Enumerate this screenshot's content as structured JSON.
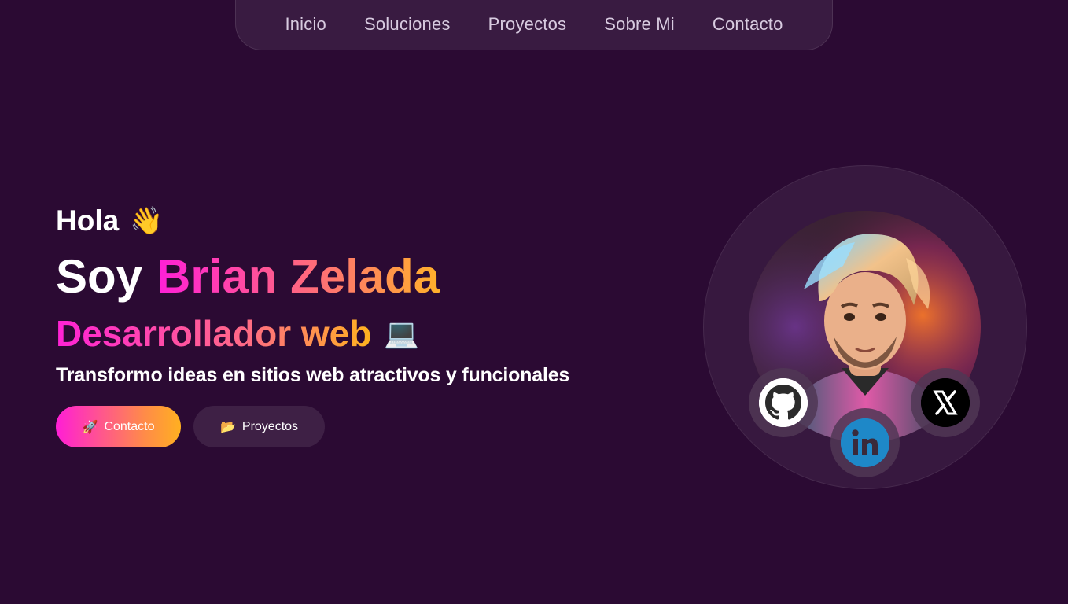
{
  "nav": {
    "items": [
      "Inicio",
      "Soluciones",
      "Proyectos",
      "Sobre Mi",
      "Contacto"
    ]
  },
  "hero": {
    "greeting": "Hola",
    "greeting_emoji": "👋",
    "intro_prefix": "Soy",
    "name": "Brian Zelada",
    "role": "Desarrollador web",
    "role_emoji": "💻",
    "tagline": "Transformo ideas en sitios web atractivos y funcionales",
    "primary_button": {
      "icon": "🚀",
      "label": "Contacto"
    },
    "secondary_button": {
      "icon": "📂",
      "label": "Proyectos"
    }
  },
  "social": {
    "links": [
      "github-icon",
      "linkedin-icon",
      "x-icon"
    ]
  },
  "colors": {
    "background": "#2b0a33",
    "gradient_start": "#ff1fd8",
    "gradient_end": "#ffb12a"
  }
}
